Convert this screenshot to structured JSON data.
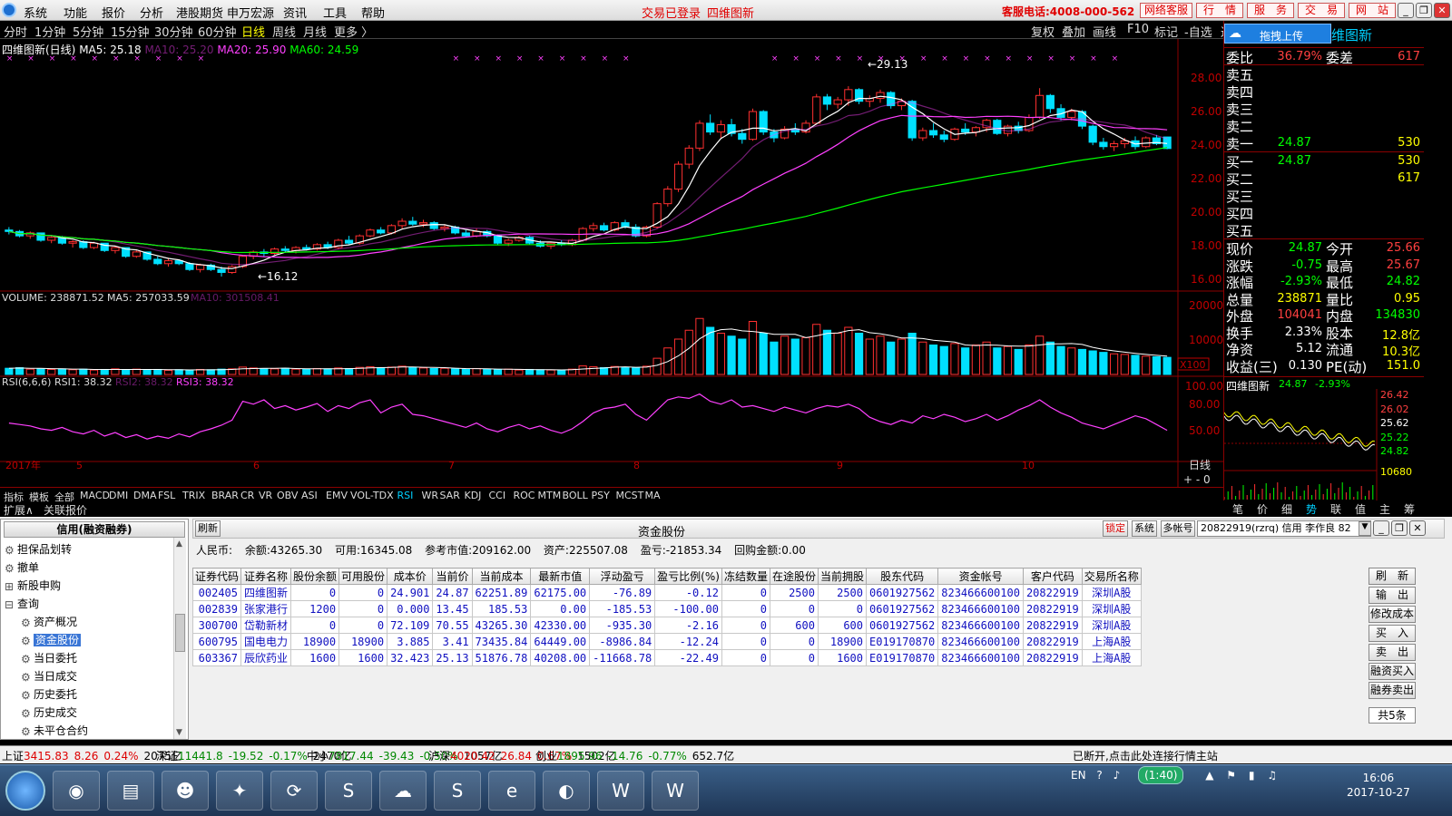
{
  "menu": {
    "items": [
      "系统",
      "功能",
      "报价",
      "分析",
      "港股期货",
      "申万宏源",
      "资讯",
      "工具",
      "帮助"
    ],
    "center": [
      "交易已登录",
      "四维图新"
    ],
    "service": "客服电话:4008-000-562",
    "buttons": [
      "网络客服",
      "行　情",
      "服　务",
      "交　易",
      "网　站"
    ]
  },
  "periods": {
    "items": [
      "分时",
      "1分钟",
      "5分钟",
      "15分钟",
      "30分钟",
      "60分钟",
      "日线",
      "周线",
      "月线",
      "更多 〉"
    ],
    "right": [
      "复权",
      "叠加",
      "画线",
      "F10",
      "标记",
      "-自选",
      "返回"
    ]
  },
  "legend": {
    "stock": "四维图新(日线)",
    "ma5": "MA5: 25.18",
    "ma10": "MA10: 25.20",
    "ma20": "MA20: 25.90",
    "ma60": "MA60: 24.59"
  },
  "chart_labels": {
    "high": "29.13",
    "low": "←16.12",
    "high_arrow": "←",
    "price_ticks": [
      "28.00",
      "26.00",
      "24.00",
      "22.00",
      "20.00",
      "18.00",
      "16.00"
    ],
    "vol_label": "VOLUME: 238871.52",
    "vol_ma5": "MA5: 257033.59",
    "vol_ma10": "MA10: 301508.41",
    "vol_ticks": [
      "20000",
      "10000"
    ],
    "vol_unit": "X100",
    "rsi_label": "RSI(6,6,6)",
    "rsi1": "RSI1: 38.32",
    "rsi2": "RSI2: 38.32",
    "rsi3": "RSI3: 38.32",
    "rsi_ticks": [
      "100.00",
      "80.00",
      "50.00"
    ],
    "date_labels": [
      "2017年",
      "5",
      "6",
      "7",
      "8",
      "9",
      "10"
    ],
    "period_right": "日线"
  },
  "indicator_tabs": [
    "指标",
    "模板",
    "全部",
    "MACD",
    "DMI",
    "DMA",
    "FSL",
    "TRIX",
    "BRAR",
    "CR",
    "VR",
    "OBV",
    "ASI",
    "EMV",
    "VOL-TDX",
    "RSI",
    "WR",
    "SAR",
    "KDJ",
    "CCI",
    "ROC",
    "MTM",
    "BOLL",
    "PSY",
    "MCST",
    "MA"
  ],
  "expand": [
    "扩展∧",
    "关联报价"
  ],
  "right_panel": {
    "upload": "拖拽上传",
    "title": "维图新",
    "wb": {
      "label": "委比",
      "val": "36.79%",
      "label2": "委差",
      "val2": "617"
    },
    "sell": [
      {
        "l": "卖五",
        "p": "",
        "v": ""
      },
      {
        "l": "卖四",
        "p": "",
        "v": ""
      },
      {
        "l": "卖三",
        "p": "",
        "v": ""
      },
      {
        "l": "卖二",
        "p": "",
        "v": ""
      },
      {
        "l": "卖一",
        "p": "24.87",
        "v": "530"
      }
    ],
    "buy": [
      {
        "l": "买一",
        "p": "24.87",
        "v": "530"
      },
      {
        "l": "买二",
        "p": "",
        "v": "617"
      },
      {
        "l": "买三",
        "p": "",
        "v": ""
      },
      {
        "l": "买四",
        "p": "",
        "v": ""
      },
      {
        "l": "买五",
        "p": "",
        "v": ""
      }
    ],
    "stats": [
      {
        "l1": "现价",
        "v1": "24.87",
        "l2": "今开",
        "v2": "25.66"
      },
      {
        "l1": "涨跌",
        "v1": "-0.75",
        "l2": "最高",
        "v2": "25.67"
      },
      {
        "l1": "涨幅",
        "v1": "-2.93%",
        "l2": "最低",
        "v2": "24.82"
      },
      {
        "l1": "总量",
        "v1": "238871",
        "l2": "量比",
        "v2": "0.95"
      },
      {
        "l1": "外盘",
        "v1": "104041",
        "l2": "内盘",
        "v2": "134830"
      },
      {
        "l1": "换手",
        "v1": "2.33%",
        "l2": "股本",
        "v2": "12.8亿"
      },
      {
        "l1": "净资",
        "v1": "5.12",
        "l2": "流通",
        "v2": "10.3亿"
      },
      {
        "l1": "收益(三)",
        "v1": "0.130",
        "l2": "PE(动)",
        "v2": "151.0"
      }
    ],
    "mini_title": "四维图新",
    "mini_price": "24.87",
    "mini_pct": "-2.93%",
    "mini_ticks": [
      "26.42",
      "26.02",
      "25.62",
      "25.22",
      "24.82",
      "10680"
    ],
    "mini_tabs": [
      "笔",
      "价",
      "细",
      "势",
      "联",
      "值",
      "主",
      "筹"
    ]
  },
  "tree": {
    "header": "信用(融资融券)",
    "items": [
      {
        "label": "担保品划转",
        "icon": "gear"
      },
      {
        "label": "撤单",
        "icon": "gear"
      },
      {
        "label": "新股申购",
        "icon": "plus"
      },
      {
        "label": "查询",
        "icon": "minus"
      },
      {
        "label": "资产概况",
        "icon": "gear"
      },
      {
        "label": "资金股份",
        "icon": "gear"
      },
      {
        "label": "当日委托",
        "icon": "gear"
      },
      {
        "label": "当日成交",
        "icon": "gear"
      },
      {
        "label": "历史委托",
        "icon": "gear"
      },
      {
        "label": "历史成交",
        "icon": "gear"
      },
      {
        "label": "未平仓合约",
        "icon": "gear"
      }
    ]
  },
  "account": {
    "refresh": "刷新",
    "title": "资金股份",
    "lock": "锁定",
    "sys": "系统",
    "multi": "多帐号",
    "account_sel": "20822919(rzrq) 信用 李作良 82",
    "summary": [
      "人民币:",
      "余额:43265.30",
      "可用:16345.08",
      "参考市值:209162.00",
      "资产:225507.08",
      "盈亏:-21853.34",
      "回购金额:0.00"
    ],
    "columns": [
      "证券代码",
      "证券名称",
      "股份余额",
      "可用股份",
      "成本价",
      "当前价",
      "当前成本",
      "最新市值",
      "浮动盈亏",
      "盈亏比例(%)",
      "冻结数量",
      "在途股份",
      "当前拥股",
      "股东代码",
      "资金帐号",
      "客户代码",
      "交易所名称"
    ],
    "rows": [
      [
        "002405",
        "四维图新",
        "0",
        "0",
        "24.901",
        "24.87",
        "62251.89",
        "62175.00",
        "-76.89",
        "-0.12",
        "0",
        "2500",
        "2500",
        "0601927562",
        "823466600100",
        "20822919",
        "深圳A股"
      ],
      [
        "002839",
        "张家港行",
        "1200",
        "0",
        "0.000",
        "13.45",
        "185.53",
        "0.00",
        "-185.53",
        "-100.00",
        "0",
        "0",
        "0",
        "0601927562",
        "823466600100",
        "20822919",
        "深圳A股"
      ],
      [
        "300700",
        "岱勒新材",
        "0",
        "0",
        "72.109",
        "70.55",
        "43265.30",
        "42330.00",
        "-935.30",
        "-2.16",
        "0",
        "600",
        "600",
        "0601927562",
        "823466600100",
        "20822919",
        "深圳A股"
      ],
      [
        "600795",
        "国电电力",
        "18900",
        "18900",
        "3.885",
        "3.41",
        "73435.84",
        "64449.00",
        "-8986.84",
        "-12.24",
        "0",
        "0",
        "18900",
        "E019170870",
        "823466600100",
        "20822919",
        "上海A股"
      ],
      [
        "603367",
        "辰欣药业",
        "1600",
        "1600",
        "32.423",
        "25.13",
        "51876.78",
        "40208.00",
        "-11668.78",
        "-22.49",
        "0",
        "0",
        "1600",
        "E019170870",
        "823466600100",
        "20822919",
        "上海A股"
      ]
    ],
    "actions": [
      "刷　新",
      "输　出",
      "修改成本",
      "买　入",
      "卖　出",
      "融资买入",
      "融券卖出"
    ],
    "count": "共5条"
  },
  "status": {
    "items": [
      {
        "n": "上证",
        "v": "3415.83",
        "c": "8.26",
        "p": "0.24%",
        "a": "2075亿"
      },
      {
        "n": "深证",
        "v": "11441.8",
        "c": "-19.52",
        "p": "-0.17%",
        "a": "2470亿"
      },
      {
        "n": "中小",
        "v": "7817.44",
        "c": "-39.43",
        "p": "-0.50%",
        "a": "1057亿"
      },
      {
        "n": "沪深",
        "v": "4020.42",
        "c": "26.84",
        "p": "0.67%",
        "a": "1502亿"
      },
      {
        "n": "创业",
        "v": "1895.96",
        "c": "-14.76",
        "p": "-0.77%",
        "a": "652.7亿"
      }
    ],
    "msg": "已断开,点击此处连接行情主站"
  },
  "taskbar": {
    "time": "16:06",
    "date": "2017-10-27",
    "lang": "EN",
    "timer": "(1:40)"
  },
  "chart_data": {
    "type": "candlestick",
    "ylim": [
      15.5,
      30.5
    ],
    "ohlc": [
      [
        19.3,
        19.5,
        19.0,
        19.2
      ],
      [
        19.2,
        19.3,
        18.8,
        18.9
      ],
      [
        18.9,
        19.2,
        18.7,
        19.1
      ],
      [
        19.1,
        19.1,
        18.5,
        18.6
      ],
      [
        18.6,
        18.9,
        18.4,
        18.8
      ],
      [
        18.8,
        18.9,
        18.3,
        18.4
      ],
      [
        18.4,
        18.6,
        18.1,
        18.5
      ],
      [
        18.5,
        18.6,
        18.0,
        18.1
      ],
      [
        18.1,
        18.5,
        18.0,
        18.4
      ],
      [
        18.4,
        18.4,
        17.8,
        17.9
      ],
      [
        17.9,
        18.2,
        17.7,
        18.1
      ],
      [
        18.1,
        18.1,
        17.4,
        17.5
      ],
      [
        17.5,
        17.9,
        17.4,
        17.8
      ],
      [
        17.8,
        17.8,
        17.2,
        17.3
      ],
      [
        17.3,
        17.5,
        16.9,
        17.0
      ],
      [
        17.0,
        17.4,
        16.8,
        17.2
      ],
      [
        17.2,
        17.3,
        16.9,
        17.0
      ],
      [
        17.0,
        17.1,
        16.5,
        16.6
      ],
      [
        16.6,
        17.0,
        16.4,
        16.9
      ],
      [
        16.9,
        17.0,
        16.5,
        16.6
      ],
      [
        16.6,
        16.8,
        16.12,
        16.4
      ],
      [
        16.4,
        16.9,
        16.3,
        16.8
      ],
      [
        16.8,
        17.6,
        16.7,
        17.5
      ],
      [
        17.5,
        17.9,
        17.3,
        17.8
      ],
      [
        17.8,
        18.0,
        17.5,
        17.7
      ],
      [
        17.7,
        18.1,
        17.6,
        18.0
      ],
      [
        18.0,
        18.2,
        17.8,
        17.9
      ],
      [
        17.9,
        18.2,
        17.7,
        18.1
      ],
      [
        18.1,
        18.3,
        17.9,
        18.0
      ],
      [
        18.0,
        18.4,
        17.9,
        18.3
      ],
      [
        18.3,
        18.5,
        18.0,
        18.1
      ],
      [
        18.1,
        18.7,
        18.0,
        18.6
      ],
      [
        18.6,
        18.9,
        18.3,
        18.4
      ],
      [
        18.4,
        19.0,
        18.3,
        18.9
      ],
      [
        18.9,
        19.4,
        18.8,
        19.3
      ],
      [
        19.3,
        19.5,
        19.0,
        19.1
      ],
      [
        19.1,
        19.7,
        19.0,
        19.6
      ],
      [
        19.6,
        20.1,
        19.4,
        19.9
      ],
      [
        19.9,
        20.2,
        19.6,
        19.7
      ],
      [
        19.7,
        20.0,
        19.5,
        19.8
      ],
      [
        19.8,
        19.9,
        19.3,
        19.4
      ],
      [
        19.4,
        19.7,
        19.2,
        19.5
      ],
      [
        19.5,
        19.6,
        19.0,
        19.1
      ],
      [
        19.1,
        19.3,
        18.8,
        18.9
      ],
      [
        18.9,
        19.4,
        18.8,
        19.2
      ],
      [
        19.2,
        19.3,
        18.8,
        18.9
      ],
      [
        18.9,
        19.0,
        18.3,
        18.4
      ],
      [
        18.4,
        18.7,
        18.2,
        18.6
      ],
      [
        18.6,
        18.9,
        18.5,
        18.8
      ],
      [
        18.8,
        18.9,
        18.3,
        18.4
      ],
      [
        18.4,
        18.6,
        18.1,
        18.2
      ],
      [
        18.2,
        18.5,
        18.0,
        18.4
      ],
      [
        18.4,
        18.6,
        18.2,
        18.3
      ],
      [
        18.3,
        18.7,
        18.2,
        18.6
      ],
      [
        18.6,
        19.5,
        18.5,
        19.4
      ],
      [
        19.4,
        19.8,
        19.2,
        19.6
      ],
      [
        19.6,
        19.8,
        19.2,
        19.3
      ],
      [
        19.3,
        19.9,
        19.2,
        19.8
      ],
      [
        19.8,
        20.0,
        19.4,
        19.5
      ],
      [
        19.5,
        19.7,
        18.8,
        18.9
      ],
      [
        18.9,
        19.6,
        18.8,
        19.5
      ],
      [
        19.5,
        21.2,
        19.4,
        21.1
      ],
      [
        21.1,
        22.3,
        20.9,
        22.1
      ],
      [
        22.1,
        24.0,
        21.9,
        23.8
      ],
      [
        23.8,
        25.1,
        23.5,
        24.9
      ],
      [
        24.9,
        26.8,
        24.7,
        26.6
      ],
      [
        26.6,
        27.2,
        25.8,
        26.0
      ],
      [
        26.0,
        26.8,
        25.6,
        26.5
      ],
      [
        26.5,
        26.9,
        25.7,
        25.9
      ],
      [
        25.9,
        26.2,
        25.2,
        25.5
      ],
      [
        25.5,
        27.6,
        25.4,
        27.4
      ],
      [
        27.4,
        27.5,
        25.8,
        26.0
      ],
      [
        26.0,
        26.2,
        25.3,
        25.6
      ],
      [
        25.6,
        26.4,
        25.5,
        26.2
      ],
      [
        26.2,
        26.6,
        25.8,
        26.0
      ],
      [
        26.0,
        26.8,
        25.9,
        26.6
      ],
      [
        26.6,
        28.6,
        26.5,
        28.4
      ],
      [
        28.4,
        28.6,
        27.5,
        27.9
      ],
      [
        27.9,
        28.4,
        27.6,
        28.2
      ],
      [
        28.2,
        29.13,
        27.8,
        28.9
      ],
      [
        28.9,
        29.0,
        27.9,
        28.1
      ],
      [
        28.1,
        28.5,
        27.7,
        28.3
      ],
      [
        28.3,
        28.9,
        28.0,
        28.7
      ],
      [
        28.7,
        28.8,
        27.6,
        27.8
      ],
      [
        27.8,
        28.3,
        27.5,
        28.1
      ],
      [
        28.1,
        28.2,
        25.4,
        25.6
      ],
      [
        25.6,
        26.3,
        25.4,
        26.1
      ],
      [
        26.1,
        26.6,
        25.6,
        25.8
      ],
      [
        25.8,
        26.1,
        25.3,
        25.5
      ],
      [
        25.5,
        26.3,
        25.4,
        26.2
      ],
      [
        26.2,
        26.6,
        25.8,
        26.0
      ],
      [
        26.0,
        26.4,
        25.7,
        26.3
      ],
      [
        26.3,
        26.9,
        26.0,
        26.8
      ],
      [
        26.8,
        26.9,
        25.8,
        25.9
      ],
      [
        25.9,
        26.5,
        25.7,
        26.4
      ],
      [
        26.4,
        26.7,
        25.9,
        26.1
      ],
      [
        26.1,
        27.2,
        26.0,
        27.0
      ],
      [
        27.0,
        29.0,
        26.9,
        28.5
      ],
      [
        28.5,
        28.6,
        27.3,
        27.6
      ],
      [
        27.6,
        27.9,
        26.8,
        27.0
      ],
      [
        27.0,
        27.6,
        26.8,
        27.4
      ],
      [
        27.4,
        27.5,
        26.2,
        26.4
      ],
      [
        26.4,
        26.5,
        25.1,
        25.3
      ],
      [
        25.3,
        25.6,
        24.8,
        25.0
      ],
      [
        25.0,
        25.4,
        24.7,
        25.2
      ],
      [
        25.2,
        25.6,
        24.9,
        25.4
      ],
      [
        25.4,
        25.7,
        24.8,
        25.0
      ],
      [
        25.0,
        25.7,
        24.9,
        25.6
      ],
      [
        25.6,
        25.8,
        25.1,
        25.2
      ],
      [
        25.66,
        25.67,
        24.82,
        24.87
      ]
    ],
    "volume": [
      2.1,
      2.3,
      1.8,
      2.0,
      1.7,
      1.9,
      1.6,
      1.8,
      1.5,
      1.7,
      1.9,
      1.6,
      1.8,
      1.5,
      1.7,
      1.4,
      1.6,
      1.5,
      1.7,
      1.6,
      1.8,
      1.9,
      2.5,
      2.2,
      2.0,
      1.9,
      2.1,
      1.8,
      1.7,
      2.0,
      1.9,
      2.2,
      2.0,
      2.4,
      2.6,
      2.3,
      2.5,
      2.8,
      2.4,
      2.2,
      2.0,
      2.1,
      1.9,
      1.8,
      2.0,
      1.7,
      1.6,
      1.8,
      1.5,
      1.7,
      1.6,
      1.5,
      1.4,
      1.8,
      2.9,
      2.6,
      2.3,
      2.7,
      2.4,
      2.2,
      2.8,
      5.5,
      9.0,
      12.0,
      15.0,
      19.0,
      16.0,
      14.0,
      13.0,
      12.0,
      18.0,
      14.0,
      11.0,
      13.0,
      12.0,
      12.5,
      17.0,
      15.0,
      14.0,
      16.0,
      14.0,
      12.0,
      13.0,
      11.0,
      12.0,
      14.0,
      11.0,
      10.0,
      9.5,
      10.5,
      9.0,
      10.0,
      11.0,
      9.0,
      9.5,
      8.5,
      10.0,
      13.0,
      11.0,
      9.5,
      9.0,
      8.5,
      8.0,
      7.5,
      7.0,
      6.8,
      6.5,
      6.2,
      6.0,
      5.8
    ],
    "rsi": [
      48,
      46,
      44,
      40,
      38,
      42,
      36,
      33,
      38,
      30,
      35,
      28,
      32,
      26,
      30,
      27,
      33,
      29,
      36,
      40,
      45,
      52,
      78,
      74,
      80,
      68,
      72,
      66,
      70,
      75,
      64,
      72,
      68,
      76,
      80,
      62,
      70,
      74,
      60,
      58,
      54,
      50,
      46,
      42,
      48,
      40,
      36,
      42,
      46,
      40,
      44,
      38,
      34,
      40,
      50,
      62,
      68,
      70,
      74,
      60,
      52,
      66,
      80,
      84,
      82,
      88,
      78,
      74,
      80,
      70,
      72,
      68,
      64,
      70,
      66,
      62,
      68,
      72,
      70,
      74,
      68,
      56,
      50,
      46,
      52,
      48,
      58,
      54,
      60,
      56,
      50,
      54,
      60,
      52,
      58,
      66,
      72,
      80,
      70,
      62,
      56,
      48,
      44,
      40,
      46,
      52,
      58,
      54,
      46,
      38
    ],
    "ma_series": [
      "MA5",
      "MA10",
      "MA20",
      "MA60"
    ]
  }
}
